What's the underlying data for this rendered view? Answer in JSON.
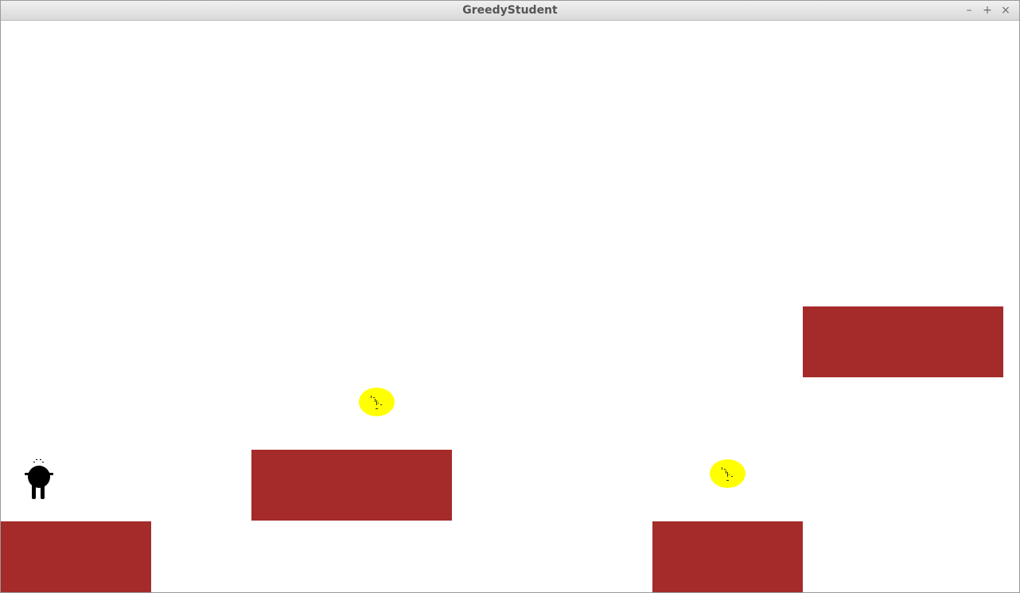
{
  "window": {
    "title": "GreedyStudent",
    "controls": {
      "minimize": "–",
      "maximize": "+",
      "close": "×"
    }
  },
  "game": {
    "background_color": "#ffffff",
    "platform_color": "#a52a2a",
    "coin_color": "#ffff00",
    "player_color": "#000000",
    "platform_count": 4,
    "coin_count": 2
  }
}
